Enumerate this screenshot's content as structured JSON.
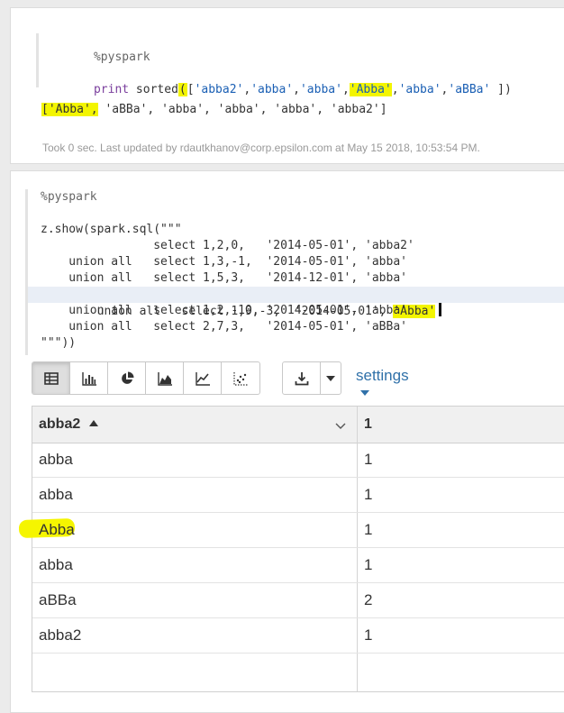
{
  "paragraph1": {
    "code_lines": [
      "%pyspark",
      "",
      "print sorted(['abba2','abba','abba','Abba','abba','aBBa' ])"
    ],
    "output": "['Abba', 'aBBa', 'abba', 'abba', 'abba', 'abba2']",
    "status": "Took 0 sec. Last updated by rdautkhanov@corp.epsilon.com at May 15 2018, 10:53:54 PM."
  },
  "paragraph2": {
    "code_lines": [
      "%pyspark",
      "",
      "z.show(spark.sql(\"\"\"",
      "                select 1,2,0,   '2014-05-01', 'abba2'",
      "    union all   select 1,3,-1,  '2014-05-01', 'abba'",
      "    union all   select 1,5,3,   '2014-12-01', 'abba'",
      "    union all   select 1,9,-3,  '2014-05-01', 'Abba'",
      "    union all   select 1,2,-10, '2014-05-01', 'abba'",
      "    union all   select 2,7,3,   '2014-05-01', 'aBBa'",
      "\"\"\"))"
    ],
    "toolbar": {
      "view_buttons": [
        "table-icon",
        "bar-chart-icon",
        "pie-chart-icon",
        "area-chart-icon",
        "line-chart-icon",
        "scatter-chart-icon"
      ],
      "download_icon": "download-icon",
      "settings_label": "settings"
    },
    "table": {
      "columns": [
        "abba2",
        "1"
      ],
      "rows": [
        [
          "abba",
          "1"
        ],
        [
          "abba",
          "1"
        ],
        [
          "Abba",
          "1"
        ],
        [
          "abba",
          "1"
        ],
        [
          "aBBa",
          "2"
        ],
        [
          "abba2",
          "1"
        ]
      ]
    }
  },
  "colors": {
    "highlight": "#f3f500",
    "link": "#3071a9"
  }
}
